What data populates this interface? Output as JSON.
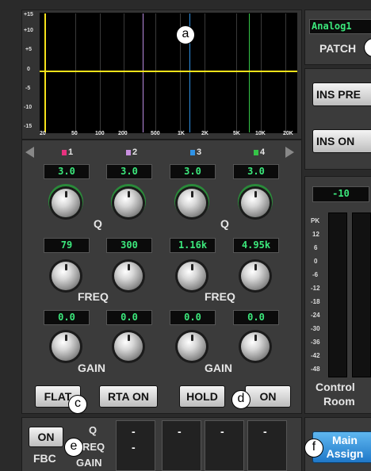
{
  "graph": {
    "y_ticks": [
      "+15",
      "+10",
      "+5",
      "0",
      "-5",
      "-10",
      "-15"
    ],
    "x_ticks": [
      "20",
      "50",
      "100",
      "200",
      "500",
      "1K",
      "2K",
      "5K",
      "10K",
      "20K"
    ],
    "callout": "a"
  },
  "patch": {
    "lcd": "Analog1",
    "label": "PATCH"
  },
  "insert": {
    "pre_label": "INS PRE",
    "on_label": "INS ON"
  },
  "bands": {
    "markers": [
      {
        "label": "1",
        "color": "#e8327f"
      },
      {
        "label": "2",
        "color": "#c98fe0"
      },
      {
        "label": "3",
        "color": "#2f93e6"
      },
      {
        "label": "4",
        "color": "#35c447"
      }
    ],
    "q_values": [
      "3.0",
      "3.0",
      "3.0",
      "3.0"
    ],
    "freq_values": [
      "79",
      "300",
      "1.16k",
      "4.95k"
    ],
    "gain_values": [
      "0.0",
      "0.0",
      "0.0",
      "0.0"
    ],
    "q_label": "Q",
    "freq_label": "FREQ",
    "gain_label": "GAIN"
  },
  "buttons": {
    "flat": "FLAT",
    "rta_on": "RTA ON",
    "hold": "HOLD",
    "on": "ON"
  },
  "callouts": {
    "c": "c",
    "d": "d",
    "e": "e",
    "f": "f",
    "patch": ""
  },
  "meter": {
    "lcd": "-10",
    "scale": [
      "PK",
      "12",
      "6",
      "0",
      "-6",
      "-12",
      "-18",
      "-24",
      "-30",
      "-36",
      "-42",
      "-48"
    ],
    "label_line1": "Control",
    "label_line2": "Room"
  },
  "fbc": {
    "on_label": "ON",
    "fbc_label": "FBC",
    "row_labels": [
      "Q",
      "FREQ",
      "GAIN"
    ],
    "cells": [
      "-",
      "-",
      "-",
      "-",
      "-"
    ]
  },
  "main_assign": {
    "line1": "Main",
    "line2": "Assign"
  },
  "colors": {
    "lcd_green": "#3ce87c",
    "curve": "#f6e21a",
    "panel": "#3b3b3b"
  }
}
